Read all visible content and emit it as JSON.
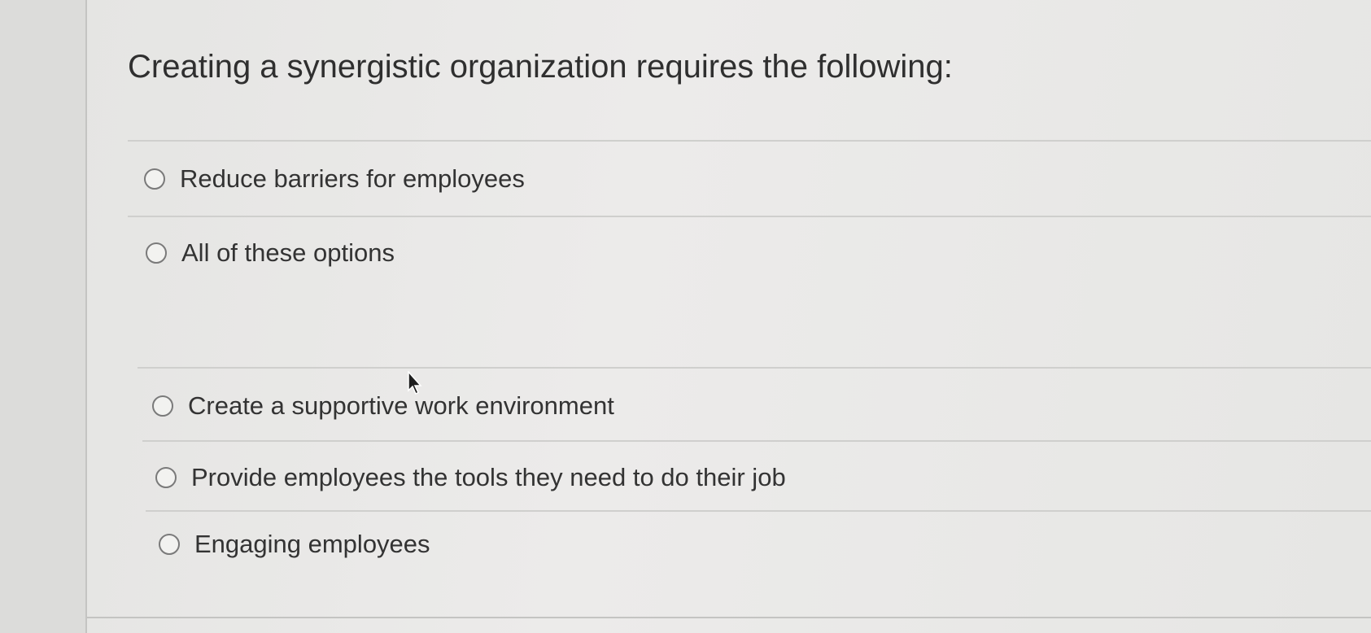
{
  "question": {
    "text": "Creating a synergistic organization requires the following:"
  },
  "options": [
    {
      "label": "Reduce barriers for employees",
      "selected": false
    },
    {
      "label": "All of these options",
      "selected": false
    },
    {
      "label": "Create a supportive work environment",
      "selected": false
    },
    {
      "label": "Provide employees the tools they need to do their job",
      "selected": false
    },
    {
      "label": "Engaging employees",
      "selected": false
    }
  ],
  "colors": {
    "text": "#333333",
    "radio_border": "#7a7a7a",
    "divider": "#cfcfcd",
    "background": "#ecebea"
  },
  "icons": {
    "radio": "radio-button-icon",
    "cursor": "mouse-pointer-icon"
  }
}
